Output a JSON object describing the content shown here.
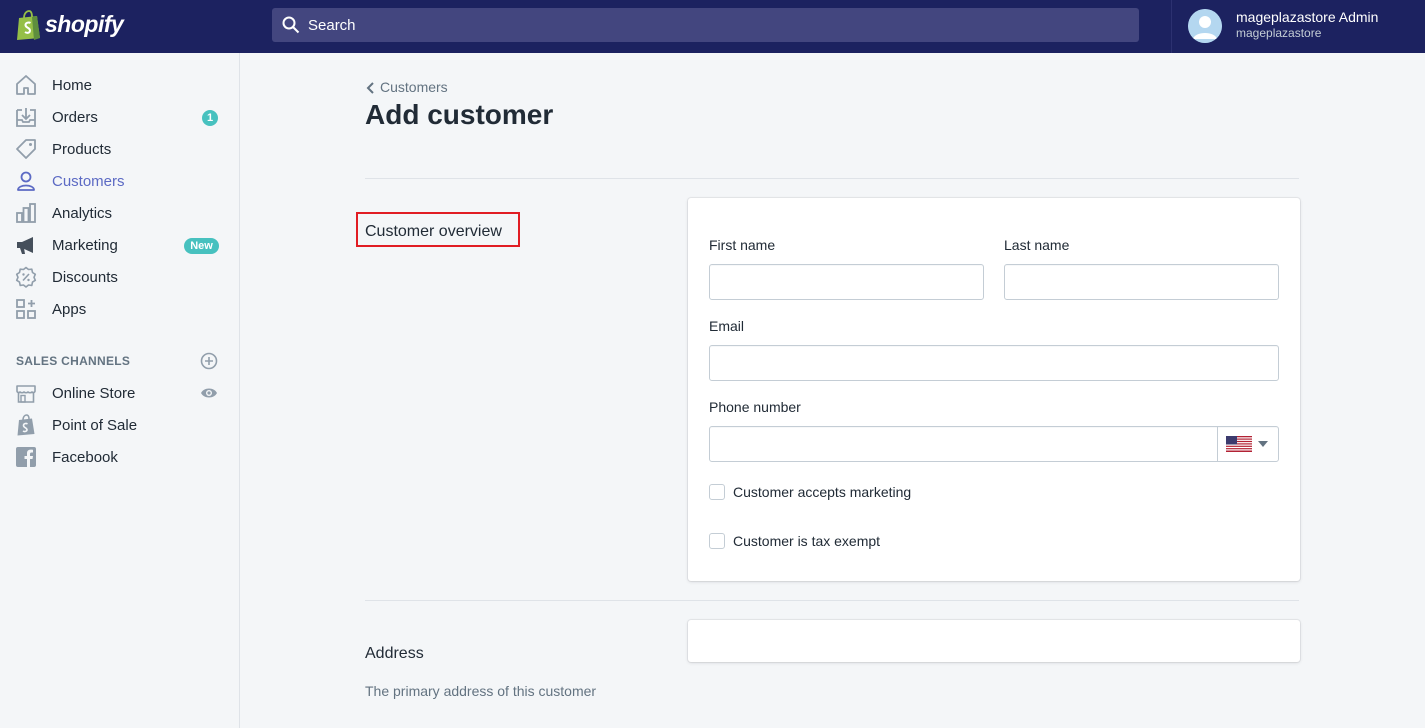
{
  "brand": {
    "logo_text": "shopify",
    "color": "#1c2260",
    "accent": "#5c6ac4",
    "badge_color": "#47c1bf"
  },
  "search": {
    "placeholder": "Search"
  },
  "user": {
    "name": "mageplazastore Admin",
    "store": "mageplazastore"
  },
  "sidebar": {
    "items": [
      {
        "label": "Home",
        "icon": "home-icon"
      },
      {
        "label": "Orders",
        "icon": "orders-icon",
        "badge": "1"
      },
      {
        "label": "Products",
        "icon": "tag-icon"
      },
      {
        "label": "Customers",
        "icon": "person-icon",
        "active": true
      },
      {
        "label": "Analytics",
        "icon": "bar-chart-icon"
      },
      {
        "label": "Marketing",
        "icon": "megaphone-icon",
        "badge": "New"
      },
      {
        "label": "Discounts",
        "icon": "discount-icon"
      },
      {
        "label": "Apps",
        "icon": "apps-icon"
      }
    ],
    "sales_channels_title": "SALES CHANNELS",
    "channels": [
      {
        "label": "Online Store",
        "icon": "store-icon"
      },
      {
        "label": "Point of Sale",
        "icon": "pos-icon"
      },
      {
        "label": "Facebook",
        "icon": "facebook-icon"
      }
    ]
  },
  "page": {
    "breadcrumb": "Customers",
    "title": "Add customer",
    "overview": {
      "heading": "Customer overview",
      "first_name_label": "First name",
      "first_name_value": "",
      "last_name_label": "Last name",
      "last_name_value": "",
      "email_label": "Email",
      "email_value": "",
      "phone_label": "Phone number",
      "phone_value": "",
      "phone_country": "US",
      "accepts_marketing_label": "Customer accepts marketing",
      "accepts_marketing_checked": false,
      "tax_exempt_label": "Customer is tax exempt",
      "tax_exempt_checked": false
    },
    "address": {
      "heading": "Address",
      "description": "The primary address of this customer"
    }
  }
}
